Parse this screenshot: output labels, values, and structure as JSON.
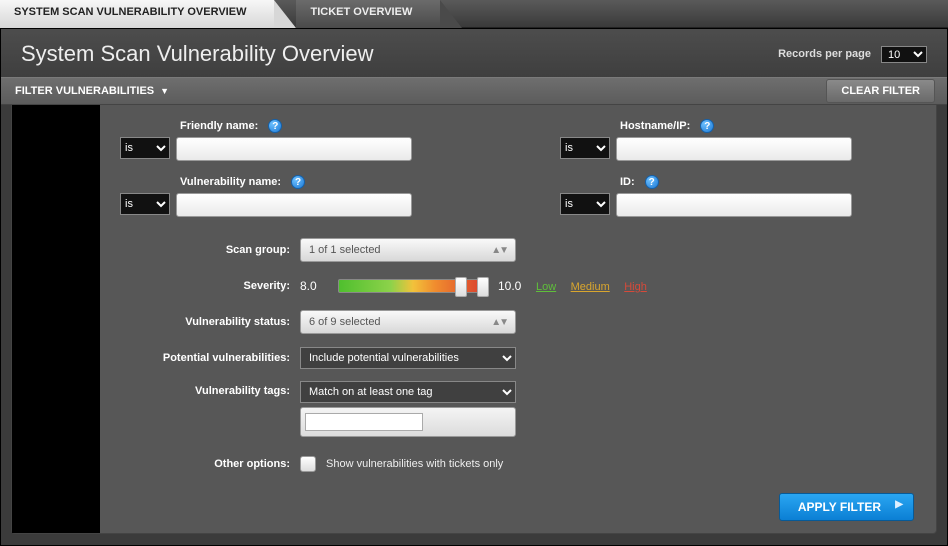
{
  "tabs": {
    "active": "SYSTEM SCAN VULNERABILITY OVERVIEW",
    "inactive": "TICKET OVERVIEW"
  },
  "page_title": "System Scan Vulnerability Overview",
  "records": {
    "label": "Records per page",
    "value": "10"
  },
  "filter_header": {
    "title": "FILTER VULNERABILITIES",
    "clear_label": "CLEAR FILTER"
  },
  "fields": {
    "friendly_name": {
      "label": "Friendly name:",
      "op": "is",
      "value": ""
    },
    "hostname_ip": {
      "label": "Hostname/IP:",
      "op": "is",
      "value": ""
    },
    "vuln_name": {
      "label": "Vulnerability name:",
      "op": "is",
      "value": ""
    },
    "id": {
      "label": "ID:",
      "op": "is",
      "value": ""
    }
  },
  "rows": {
    "scan_group": {
      "label": "Scan group:",
      "selected": "1 of 1 selected"
    },
    "severity": {
      "label": "Severity:",
      "min": "8.0",
      "max": "10.0",
      "links": {
        "low": "Low",
        "medium": "Medium",
        "high": "High"
      }
    },
    "vuln_status": {
      "label": "Vulnerability status:",
      "selected": "6 of 9 selected"
    },
    "potential": {
      "label": "Potential vulnerabilities:",
      "selected": "Include potential vulnerabilities"
    },
    "tags": {
      "label": "Vulnerability tags:",
      "selected": "Match on at least one tag",
      "tag_input": ""
    },
    "other": {
      "label": "Other options:",
      "checkbox_label": "Show vulnerabilities with tickets only"
    }
  },
  "apply_label": "APPLY FILTER"
}
